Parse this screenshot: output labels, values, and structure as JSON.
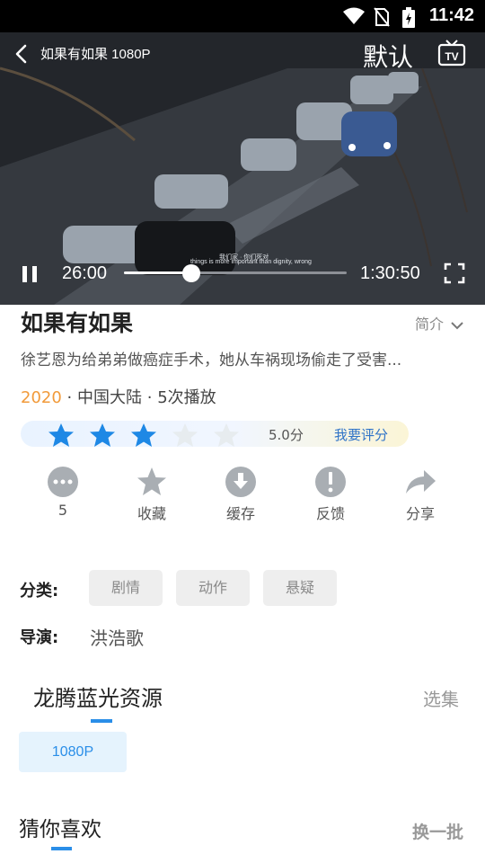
{
  "status_bar": {
    "time": "11:42",
    "icons": [
      "wifi-icon",
      "no-sim-icon",
      "battery-charging-icon"
    ]
  },
  "player": {
    "title": "如果有如果 1080P",
    "quality_label": "默认",
    "tv_label": "TV",
    "current_time": "26:00",
    "total_time": "1:30:50",
    "progress_fraction": 0.301,
    "subtitle_line1": "我们家 · 你们死对",
    "subtitle_line2": "things is more important than dignity, wrong"
  },
  "detail": {
    "title": "如果有如果",
    "intro_label": "简介",
    "description": "徐艺恩为给弟弟做癌症手术，她从车祸现场偷走了受害...",
    "year": "2020",
    "region": "中国大陆",
    "plays": "5次播放",
    "separator": "·",
    "rating": {
      "stars_filled": 3,
      "stars_total": 5,
      "score_text": "5.0分",
      "rate_link": "我要评分"
    }
  },
  "actions": [
    {
      "icon": "comment-icon",
      "label": "5"
    },
    {
      "icon": "star-icon",
      "label": "收藏"
    },
    {
      "icon": "download-icon",
      "label": "缓存"
    },
    {
      "icon": "feedback-icon",
      "label": "反馈"
    },
    {
      "icon": "share-icon",
      "label": "分享"
    }
  ],
  "category": {
    "label": "分类:",
    "tags": [
      "剧情",
      "动作",
      "悬疑"
    ]
  },
  "director": {
    "label": "导演:",
    "name": "洪浩歌"
  },
  "source": {
    "name": "龙腾蓝光资源",
    "select_label": "选集",
    "episodes": [
      "1080P"
    ]
  },
  "guess": {
    "title": "猜你喜欢",
    "refresh_label": "换一批"
  },
  "colors": {
    "accent": "#2a8ee8",
    "year": "#f19a3a",
    "star_filled": "#1e88e5",
    "star_empty": "#e7ecef"
  }
}
